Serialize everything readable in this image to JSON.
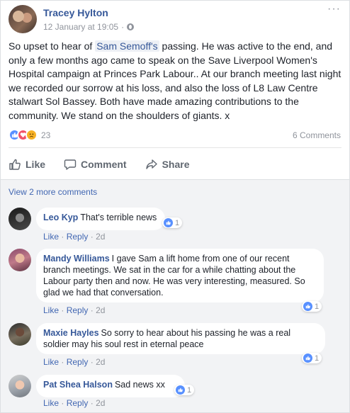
{
  "post": {
    "author": "Tracey Hylton",
    "timestamp": "12 January at 19:05",
    "separator": "·",
    "text_before": "So upset to hear of ",
    "mention": "Sam Semoff's",
    "text_after": " passing. He was active to the end, and only a few months ago came to speak on the Save Liverpool Women's Hospital campaign at Princes Park Labour.. At our branch meeting last night we recorded our sorrow at his loss, and also the loss of L8 Law Centre stalwart Sol Bassey. Both have made amazing contributions to the community. We stand on the shoulders of giants. x",
    "reaction_icons": [
      "like-icon",
      "love-icon",
      "sad-icon"
    ],
    "reaction_count": "23",
    "comment_count": "6 Comments"
  },
  "actions": {
    "like": "Like",
    "comment": "Comment",
    "share": "Share"
  },
  "view_more": "View 2 more comments",
  "comments": [
    {
      "name": "Leo Kyp",
      "text": "That's terrible news",
      "likes": "1",
      "like_label": "Like",
      "reply_label": "Reply",
      "sep": "·",
      "time": "2d"
    },
    {
      "name": "Mandy Williams",
      "text": "I gave Sam a lift home from one of our recent branch meetings. We sat in the car for a while chatting about the Labour party then and now. He was very interesting, measured. So glad we had that conversation.",
      "likes": "1",
      "like_label": "Like",
      "reply_label": "Reply",
      "sep": "·",
      "time": "2d"
    },
    {
      "name": "Maxie Hayles",
      "text": "So sorry to hear about his passing he was a real soldier may his soul rest in eternal peace",
      "likes": "1",
      "like_label": "Like",
      "reply_label": "Reply",
      "sep": "·",
      "time": "2d"
    },
    {
      "name": "Pat Shea Halson",
      "text": "Sad news xx",
      "likes": "1",
      "like_label": "Like",
      "reply_label": "Reply",
      "sep": "·",
      "time": "2d"
    }
  ],
  "colors": {
    "link": "#365899",
    "muted": "#90949c",
    "like_blue": "#5890ff"
  }
}
